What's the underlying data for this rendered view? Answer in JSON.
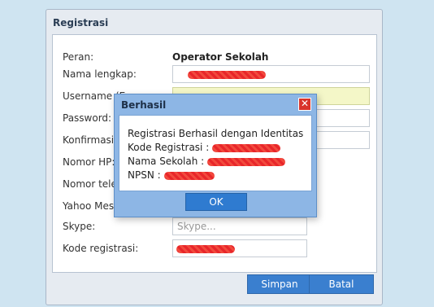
{
  "panel": {
    "title": "Registrasi"
  },
  "form": {
    "peran": {
      "label": "Peran:",
      "value": "Operator Sekolah"
    },
    "nama": {
      "label": "Nama lengkap:"
    },
    "username": {
      "label": "Username (E"
    },
    "password": {
      "label": "Password:"
    },
    "konfirmasi": {
      "label": "Konfirmasi p"
    },
    "nomor_hp": {
      "label": "Nomor HP:"
    },
    "nomor_telepon": {
      "label": "Nomor telep"
    },
    "yahoo": {
      "label": "Yahoo Mess"
    },
    "skype": {
      "label": "Skype:",
      "placeholder": "Skype..."
    },
    "kode": {
      "label": "Kode registrasi:"
    }
  },
  "footer": {
    "simpan_label": "Simpan",
    "batal_label": "Batal"
  },
  "dialog": {
    "title": "Berhasil",
    "close_glyph": "✕",
    "line1": "Registrasi Berhasil dengan Identitas",
    "line2": "Kode Registrasi :",
    "line3": "Nama Sekolah :",
    "line4": "NPSN :",
    "ok_label": "OK"
  },
  "colors": {
    "background": "#cfe4f1",
    "accent_button": "#3a7fcf",
    "dialog_frame": "#8db6e5",
    "close_button": "#d9342b",
    "highlight_field": "#f4f7c8",
    "redaction": "#e8262a"
  }
}
